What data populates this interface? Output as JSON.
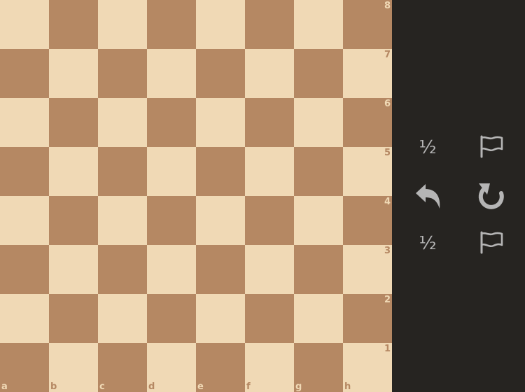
{
  "board": {
    "light_color": "#f0d9b5",
    "dark_color": "#b58863",
    "ranks": [
      "8",
      "7",
      "6",
      "5",
      "4",
      "3",
      "2",
      "1"
    ],
    "files": [
      "a",
      "b",
      "c",
      "d",
      "e",
      "f",
      "g",
      "h"
    ]
  },
  "controls": {
    "top_draw_label": "½",
    "top_resign_icon": "flag-icon",
    "takeback_icon": "undo-arrow-icon",
    "rematch_icon": "refresh-icon",
    "bottom_draw_label": "½",
    "bottom_resign_icon": "flag-icon"
  },
  "colors": {
    "panel_bg": "#262421",
    "icon": "#b5b5b5"
  }
}
